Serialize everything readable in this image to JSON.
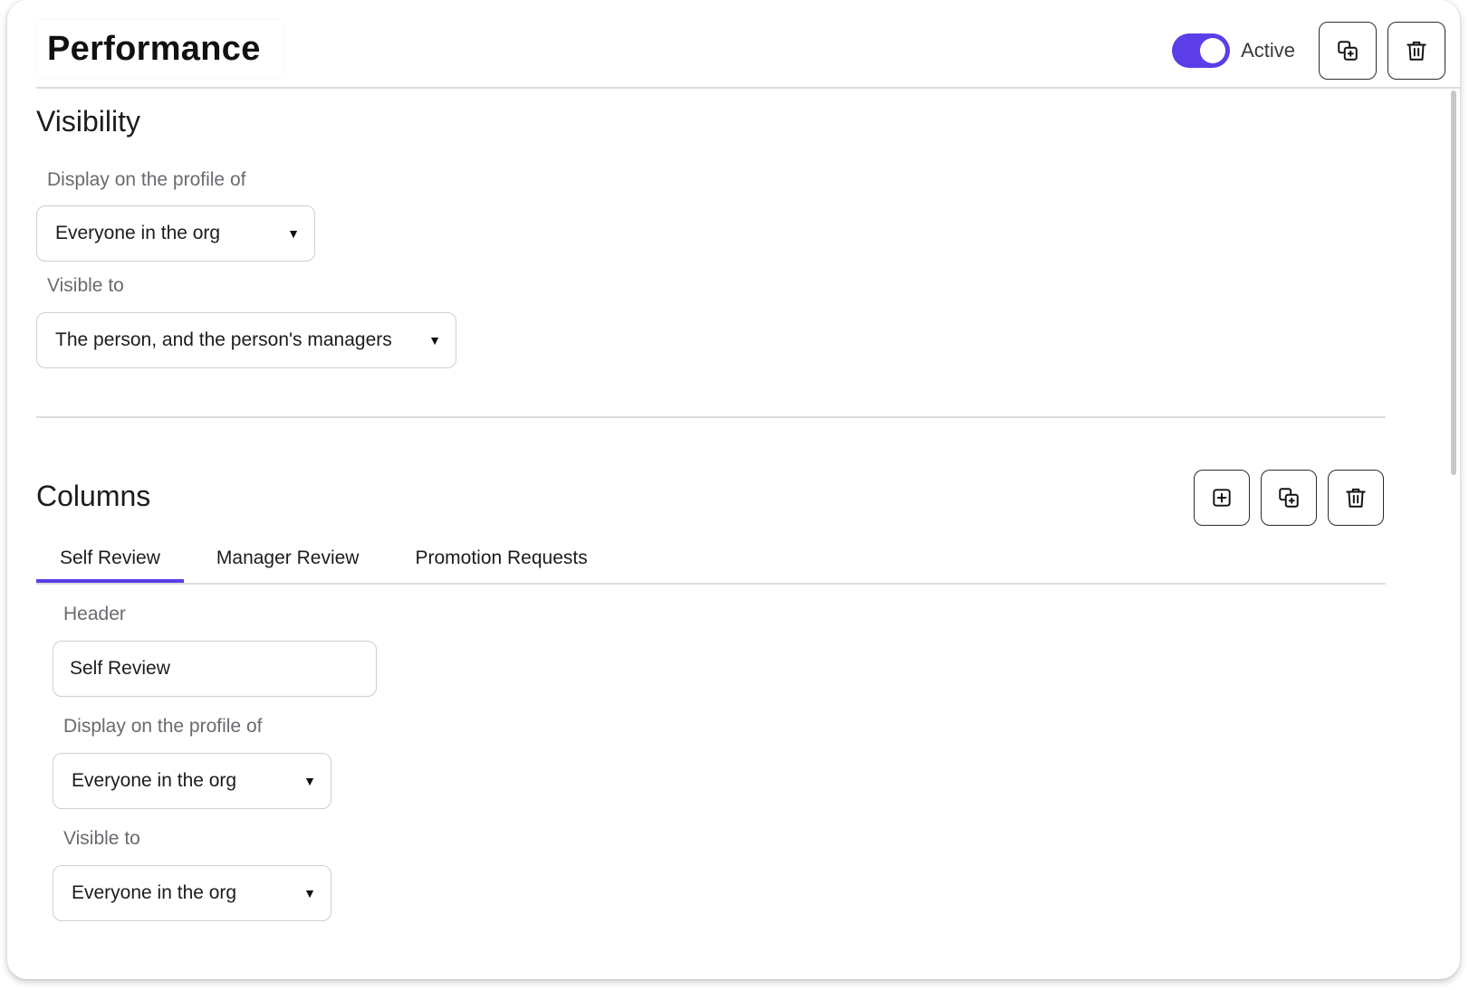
{
  "header": {
    "title": "Performance",
    "toggle_label": "Active",
    "toggle_on": true,
    "accent_color": "#5b3ee8",
    "actions": [
      {
        "name": "duplicate-button",
        "icon": "duplicate-icon"
      },
      {
        "name": "delete-button",
        "icon": "trash-icon"
      }
    ]
  },
  "visibility": {
    "title": "Visibility",
    "display_label": "Display on the profile of",
    "display_value": "Everyone in the org",
    "visible_label": "Visible to",
    "visible_value": "The person, and the person's managers"
  },
  "columns": {
    "title": "Columns",
    "actions": [
      {
        "name": "add-column-button",
        "icon": "add-square-icon"
      },
      {
        "name": "duplicate-column-button",
        "icon": "duplicate-icon"
      },
      {
        "name": "delete-column-button",
        "icon": "trash-icon"
      }
    ],
    "tabs": [
      {
        "label": "Self Review",
        "active": true
      },
      {
        "label": "Manager Review",
        "active": false
      },
      {
        "label": "Promotion Requests",
        "active": false
      }
    ],
    "form": {
      "header_label": "Header",
      "header_value": "Self Review",
      "display_label": "Display on the profile of",
      "display_value": "Everyone in the org",
      "visible_label": "Visible to",
      "visible_value": "Everyone in the org"
    }
  },
  "caret_glyph": "▼"
}
